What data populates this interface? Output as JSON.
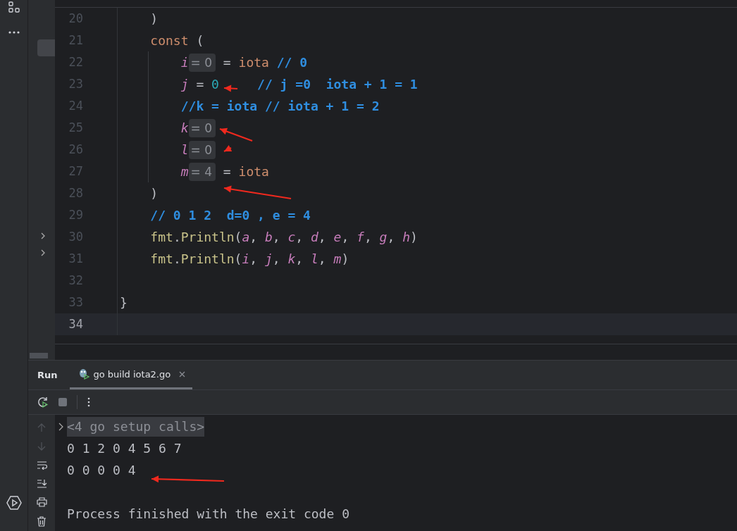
{
  "editor": {
    "lines": [
      {
        "number": "20",
        "current": false,
        "tokens": [
          {
            "kind": "plain",
            "text": "    )"
          }
        ]
      },
      {
        "number": "21",
        "current": false,
        "tokens": [
          {
            "kind": "keyword",
            "text": "    const"
          },
          {
            "kind": "plain",
            "text": " ("
          }
        ]
      },
      {
        "number": "22",
        "current": false,
        "tokens": [
          {
            "kind": "var",
            "text": "        i"
          },
          {
            "kind": "hint",
            "text": "= 0"
          },
          {
            "kind": "plain",
            "text": " = "
          },
          {
            "kind": "keyword",
            "text": "iota"
          },
          {
            "kind": "comment",
            "text": " // 0"
          }
        ]
      },
      {
        "number": "23",
        "current": false,
        "tokens": [
          {
            "kind": "var",
            "text": "        j"
          },
          {
            "kind": "plain",
            "text": " = "
          },
          {
            "kind": "num",
            "text": "0"
          },
          {
            "kind": "comment",
            "text": "     // j =0  iota + 1 = 1"
          }
        ]
      },
      {
        "number": "24",
        "current": false,
        "tokens": [
          {
            "kind": "comment",
            "text": "        //k = iota // iota + 1 = 2"
          }
        ]
      },
      {
        "number": "25",
        "current": false,
        "tokens": [
          {
            "kind": "var",
            "text": "        k"
          },
          {
            "kind": "hint",
            "text": "= 0"
          }
        ]
      },
      {
        "number": "26",
        "current": false,
        "tokens": [
          {
            "kind": "var",
            "text": "        l"
          },
          {
            "kind": "hint",
            "text": "= 0"
          }
        ]
      },
      {
        "number": "27",
        "current": false,
        "tokens": [
          {
            "kind": "var",
            "text": "        m"
          },
          {
            "kind": "hint",
            "text": "= 4"
          },
          {
            "kind": "plain",
            "text": " = "
          },
          {
            "kind": "keyword",
            "text": "iota"
          }
        ]
      },
      {
        "number": "28",
        "current": false,
        "tokens": [
          {
            "kind": "plain",
            "text": "    )"
          }
        ]
      },
      {
        "number": "29",
        "current": false,
        "tokens": [
          {
            "kind": "comment",
            "text": "    // 0 1 2  d=0 , e = 4"
          }
        ]
      },
      {
        "number": "30",
        "current": false,
        "tokens": [
          {
            "kind": "fn",
            "text": "    fmt"
          },
          {
            "kind": "plain",
            "text": "."
          },
          {
            "kind": "fn",
            "text": "Println"
          },
          {
            "kind": "plain",
            "text": "("
          },
          {
            "kind": "var",
            "text": "a"
          },
          {
            "kind": "plain",
            "text": ", "
          },
          {
            "kind": "var",
            "text": "b"
          },
          {
            "kind": "plain",
            "text": ", "
          },
          {
            "kind": "var",
            "text": "c"
          },
          {
            "kind": "plain",
            "text": ", "
          },
          {
            "kind": "var",
            "text": "d"
          },
          {
            "kind": "plain",
            "text": ", "
          },
          {
            "kind": "var",
            "text": "e"
          },
          {
            "kind": "plain",
            "text": ", "
          },
          {
            "kind": "var",
            "text": "f"
          },
          {
            "kind": "plain",
            "text": ", "
          },
          {
            "kind": "var",
            "text": "g"
          },
          {
            "kind": "plain",
            "text": ", "
          },
          {
            "kind": "var",
            "text": "h"
          },
          {
            "kind": "plain",
            "text": ")"
          }
        ]
      },
      {
        "number": "31",
        "current": false,
        "tokens": [
          {
            "kind": "fn",
            "text": "    fmt"
          },
          {
            "kind": "plain",
            "text": "."
          },
          {
            "kind": "fn",
            "text": "Println"
          },
          {
            "kind": "plain",
            "text": "("
          },
          {
            "kind": "var",
            "text": "i"
          },
          {
            "kind": "plain",
            "text": ", "
          },
          {
            "kind": "var",
            "text": "j"
          },
          {
            "kind": "plain",
            "text": ", "
          },
          {
            "kind": "var",
            "text": "k"
          },
          {
            "kind": "plain",
            "text": ", "
          },
          {
            "kind": "var",
            "text": "l"
          },
          {
            "kind": "plain",
            "text": ", "
          },
          {
            "kind": "var",
            "text": "m"
          },
          {
            "kind": "plain",
            "text": ")"
          }
        ]
      },
      {
        "number": "32",
        "current": false
      },
      {
        "number": "33",
        "current": false,
        "tokens": [
          {
            "kind": "plain",
            "text": "}"
          }
        ]
      },
      {
        "number": "34",
        "current": true
      }
    ]
  },
  "run_panel": {
    "title": "Run",
    "tabs": [
      {
        "label": "go build iota2.go",
        "selected": true
      }
    ],
    "console": [
      {
        "kind": "fold",
        "text": "<4 go setup calls>"
      },
      {
        "kind": "output",
        "text": "0 1 2 0 4 5 6 7"
      },
      {
        "kind": "output",
        "text": "0 0 0 0 4"
      },
      {
        "kind": "blank"
      },
      {
        "kind": "output",
        "text": "Process finished with the exit code 0"
      }
    ]
  }
}
